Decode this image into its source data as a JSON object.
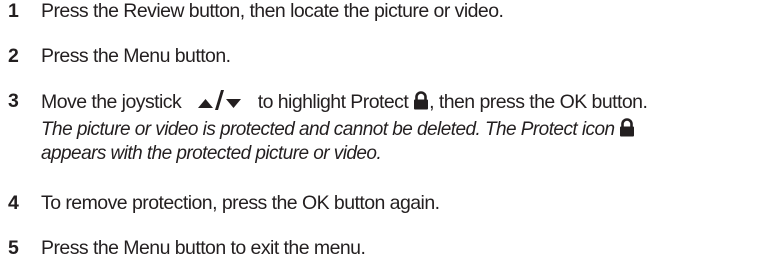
{
  "steps": [
    {
      "number": "1",
      "text": "Press the Review button, then locate the picture or video."
    },
    {
      "number": "2",
      "text": "Press the Menu button."
    },
    {
      "number": "3",
      "text_before_joystick": "Move the joystick",
      "text_middle": "to highlight Protect",
      "text_after_lock": ", then press the OK button.",
      "note_line_1": "The picture or video is protected and cannot be deleted. The Protect icon",
      "note_line_2": "appears with the protected picture or video."
    },
    {
      "number": "4",
      "text": "To remove protection, press the OK button again."
    },
    {
      "number": "5",
      "text": "Press the Menu button to exit the menu."
    }
  ],
  "icons": {
    "up_arrow": "up-arrow-icon",
    "down_arrow": "down-arrow-icon",
    "lock": "lock-icon"
  },
  "colors": {
    "text": "#231f20",
    "icon": "#231f20"
  }
}
